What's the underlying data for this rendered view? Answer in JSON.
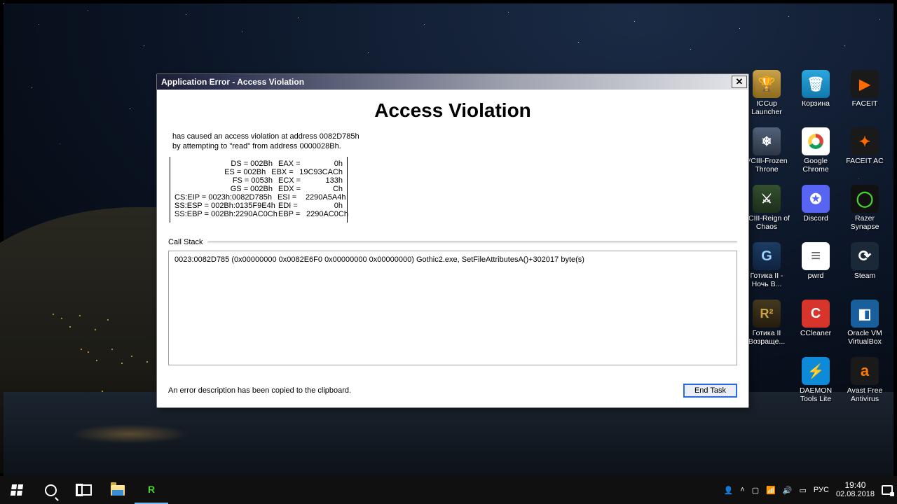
{
  "dialog": {
    "title": "Application Error - Access Violation",
    "heading": "Access Violation",
    "desc_line1": " has caused an access violation at address 0082D785h",
    "desc_line2": "by attempting to \"read\" from address 0000028Bh.",
    "registers_left": [
      "DS = 002Bh",
      "ES = 002Bh",
      "FS = 0053h",
      "GS = 002Bh",
      "CS:EIP = 0023h:0082D785h",
      "SS:ESP = 002Bh:0135F9E4h",
      "SS:EBP = 002Bh:2290AC0Ch"
    ],
    "registers_right": [
      {
        "name": "EAX =",
        "value": "0h"
      },
      {
        "name": "EBX =",
        "value": "19C93CACh"
      },
      {
        "name": "ECX =",
        "value": "133h"
      },
      {
        "name": "EDX =",
        "value": "Ch"
      },
      {
        "name": "ESI =",
        "value": "2290A5A4h"
      },
      {
        "name": "EDI =",
        "value": "0h"
      },
      {
        "name": "EBP =",
        "value": "2290AC0Ch"
      }
    ],
    "callstack_label": "Call Stack",
    "callstack_line": "0023:0082D785 (0x00000000 0x0082E6F0 0x00000000 0x00000000) Gothic2.exe, SetFileAttributesA()+302017 byte(s)",
    "clipboard_note": "An error description has been copied to the clipboard.",
    "endtask_label": "End Task"
  },
  "desktop_icons": [
    {
      "label": "ICCup Launcher",
      "cls": "ic-iccup"
    },
    {
      "label": "Корзина",
      "cls": "ic-bin"
    },
    {
      "label": "FACEIT",
      "cls": "ic-faceit"
    },
    {
      "label": "VCIII-Frozen Throne",
      "cls": "ic-wc3"
    },
    {
      "label": "Google Chrome",
      "cls": "ic-chrome"
    },
    {
      "label": "FACEIT AC",
      "cls": "ic-faceitac"
    },
    {
      "label": "VCIII-Reign of Chaos",
      "cls": "ic-roc"
    },
    {
      "label": "Discord",
      "cls": "ic-discord"
    },
    {
      "label": "Razer Synapse",
      "cls": "ic-razer"
    },
    {
      "label": "Готика II - Ночь В...",
      "cls": "ic-g2"
    },
    {
      "label": "pwrd",
      "cls": "ic-txt"
    },
    {
      "label": "Steam",
      "cls": "ic-steam"
    },
    {
      "label": "Готика II Возраще...",
      "cls": "ic-r2"
    },
    {
      "label": "CCleaner",
      "cls": "ic-ccleaner"
    },
    {
      "label": "Oracle VM VirtualBox",
      "cls": "ic-vbox"
    },
    {
      "label": "",
      "cls": ""
    },
    {
      "label": "DAEMON Tools Lite",
      "cls": "ic-daemon"
    },
    {
      "label": "Avast Free Antivirus",
      "cls": "ic-avast"
    }
  ],
  "taskbar": {
    "lang": "РУС",
    "time": "19:40",
    "date": "02.08.2018"
  }
}
